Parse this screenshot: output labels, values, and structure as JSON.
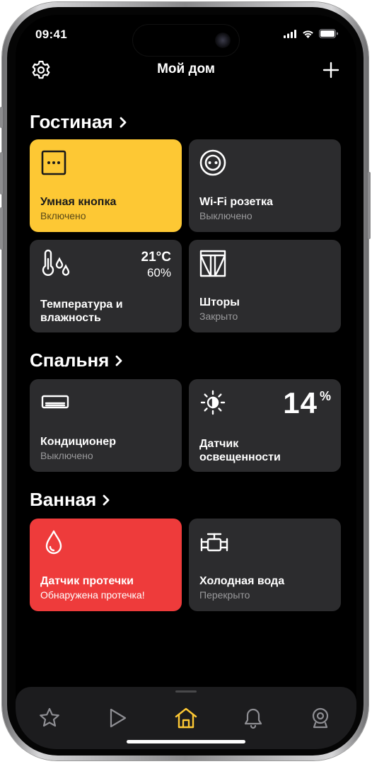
{
  "status_bar": {
    "time": "09:41"
  },
  "header": {
    "title": "Мой дом",
    "settings_icon": "gear-icon",
    "add_icon": "plus-icon"
  },
  "rooms": [
    {
      "title": "Гостиная",
      "devices": [
        {
          "name": "Умная кнопка",
          "status": "Включено",
          "icon": "smart-button-icon",
          "color": "#FDC834"
        },
        {
          "name": "Wi-Fi розетка",
          "status": "Выключено",
          "icon": "socket-icon"
        },
        {
          "name_line1": "Температура и",
          "name_line2": "влажность",
          "temperature": "21°C",
          "humidity": "60%",
          "icon": "thermometer-drops-icon"
        },
        {
          "name": "Шторы",
          "status": "Закрыто",
          "icon": "curtains-icon"
        }
      ]
    },
    {
      "title": "Спальня",
      "devices": [
        {
          "name": "Кондиционер",
          "status": "Выключено",
          "icon": "air-conditioner-icon"
        },
        {
          "name_line1": "Датчик",
          "name_line2": "освещенности",
          "value": "14",
          "unit": "%",
          "icon": "sun-icon"
        }
      ]
    },
    {
      "title": "Ванная",
      "devices": [
        {
          "name": "Датчик протечки",
          "status": "Обнаружена протечка!",
          "icon": "water-drop-icon",
          "color": "#EE3B3B"
        },
        {
          "name": "Холодная вода",
          "status": "Перекрыто",
          "icon": "valve-icon"
        }
      ]
    }
  ],
  "tabbar": {
    "items": [
      {
        "icon": "star-icon",
        "active": false
      },
      {
        "icon": "play-icon",
        "active": false
      },
      {
        "icon": "home-icon",
        "active": true,
        "color": "#FDC834"
      },
      {
        "icon": "bell-icon",
        "active": false
      },
      {
        "icon": "webcam-icon",
        "active": false
      }
    ]
  }
}
